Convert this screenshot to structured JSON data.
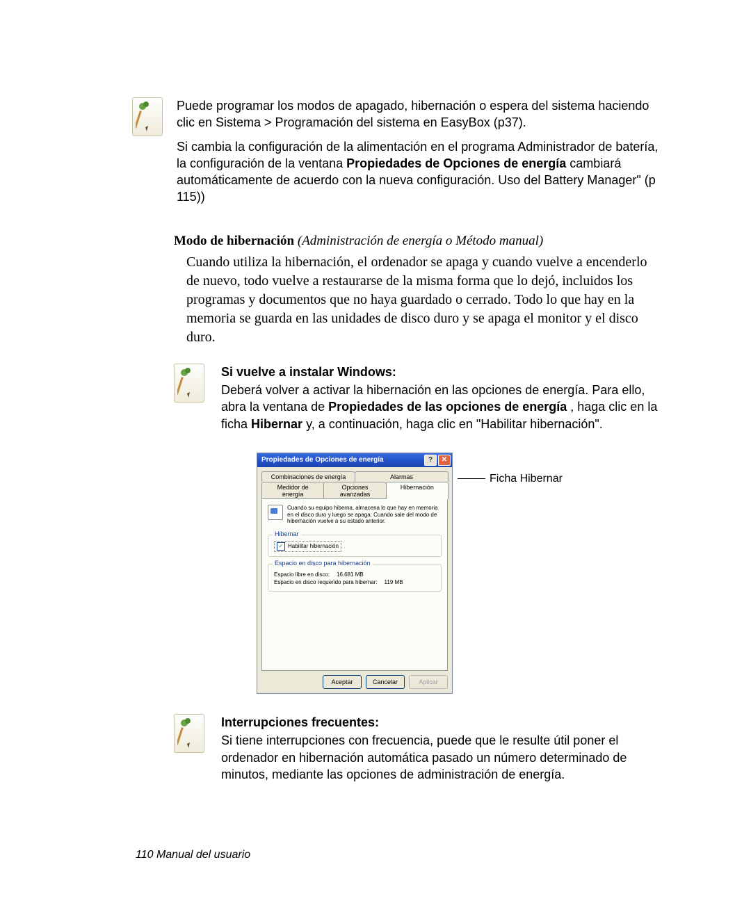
{
  "note1": {
    "p1": "Puede programar los modos de apagado, hibernación o espera del sistema haciendo clic en Sistema > Programación del sistema en EasyBox (p37).",
    "p2_pre": "Si cambia la configuración de la alimentación en el programa Administrador de batería, la configuración de la ventana ",
    "p2_bold": "Propiedades de Opciones de energía",
    "p2_post": " cambiará automáticamente de acuerdo con la nueva configuración. Uso del Battery Manager\" (p 115))"
  },
  "heading": {
    "bold": "Modo de hibernación",
    "italic": " (Administración de energía o Método manual)"
  },
  "section_para": "Cuando utiliza la hibernación, el ordenador se apaga y cuando vuelve a encenderlo de nuevo, todo vuelve a restaurarse de la misma forma que lo dejó, incluidos los programas y documentos que no haya guardado o cerrado. Todo lo que hay en la memoria se guarda en las unidades de disco duro y se apaga el monitor y el disco duro.",
  "note2": {
    "title": "Si vuelve a instalar Windows:",
    "p_pre": "Deberá volver a activar la hibernación en las opciones de energía. Para ello, abra la ventana de ",
    "p_bold1": "Propiedades de las opciones de energía",
    "p_mid": " , haga clic en la ficha ",
    "p_bold2": "Hibernar",
    "p_post": " y, a continuación, haga clic en \"Habilitar hibernación\"."
  },
  "dialog": {
    "title": "Propiedades de Opciones de energía",
    "help_btn": "?",
    "close_btn": "✕",
    "tabs_top": [
      "Combinaciones de energía",
      "Alarmas"
    ],
    "tabs_bottom": [
      "Medidor de energía",
      "Opciones avanzadas",
      "Hibernación"
    ],
    "desc": "Cuando su equipo hiberna, almacena lo que hay en memoria en el disco duro y luego se apaga. Cuando sale del modo de hibernación vuelve a su estado anterior.",
    "group1_title": "Hibernar",
    "checkbox_label": "Habilitar hibernación",
    "group2_title": "Espacio en disco para hibernación",
    "free_label": "Espacio libre en disco:",
    "free_value": "16.681 MB",
    "req_label": "Espacio en disco requerido para hibernar:",
    "req_value": "119 MB",
    "btn_ok": "Aceptar",
    "btn_cancel": "Cancelar",
    "btn_apply": "Aplicar"
  },
  "callout_label": "Ficha Hibernar",
  "note3": {
    "title": "Interrupciones frecuentes:",
    "p": "Si tiene interrupciones con frecuencia, puede que le resulte útil poner el ordenador en hibernación automática pasado un número determinado de minutos, mediante las opciones de administración de energía."
  },
  "footer": "110  Manual del usuario"
}
